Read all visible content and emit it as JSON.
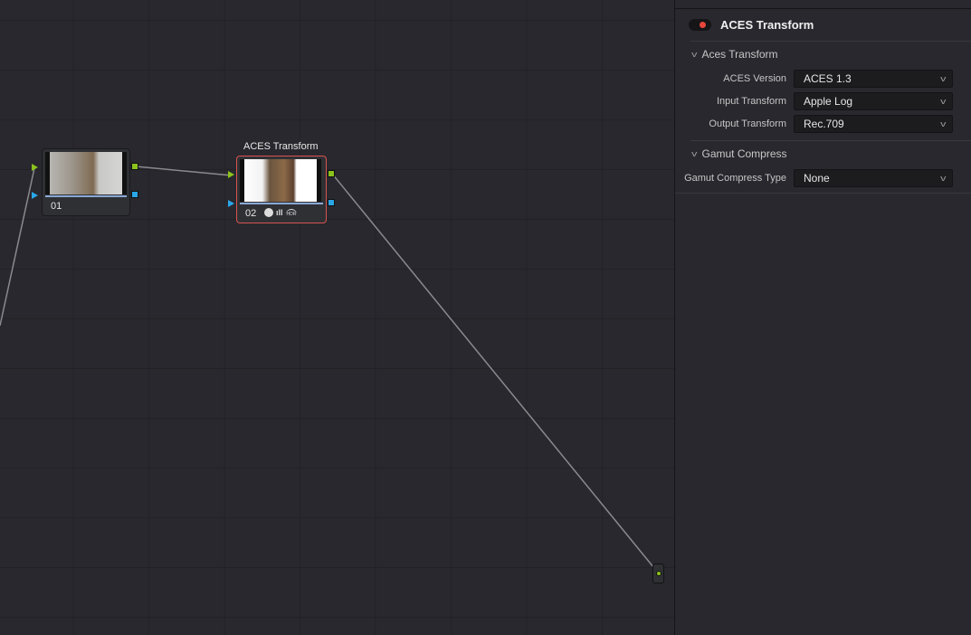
{
  "nodes": [
    {
      "label": "01",
      "title": ""
    },
    {
      "label": "02",
      "title": "ACES Transform",
      "icons": [
        "aces-icon",
        "levels-icon",
        "hdr-icon"
      ],
      "hdr_text": "HDR"
    }
  ],
  "panel": {
    "title": "ACES Transform",
    "enabled": true,
    "sections": [
      {
        "title": "Aces Transform",
        "fields": [
          {
            "label": "ACES Version",
            "value": "ACES 1.3"
          },
          {
            "label": "Input Transform",
            "value": "Apple Log"
          },
          {
            "label": "Output Transform",
            "value": "Rec.709"
          }
        ]
      },
      {
        "title": "Gamut Compress",
        "fields": [
          {
            "label": "Gamut Compress Type",
            "value": "None"
          }
        ]
      }
    ]
  },
  "colors": {
    "accent_red": "#e8463c",
    "rgb_port": "#8bc21c",
    "alpha_port": "#2aa6e8",
    "selected_node": "#d9534f"
  }
}
